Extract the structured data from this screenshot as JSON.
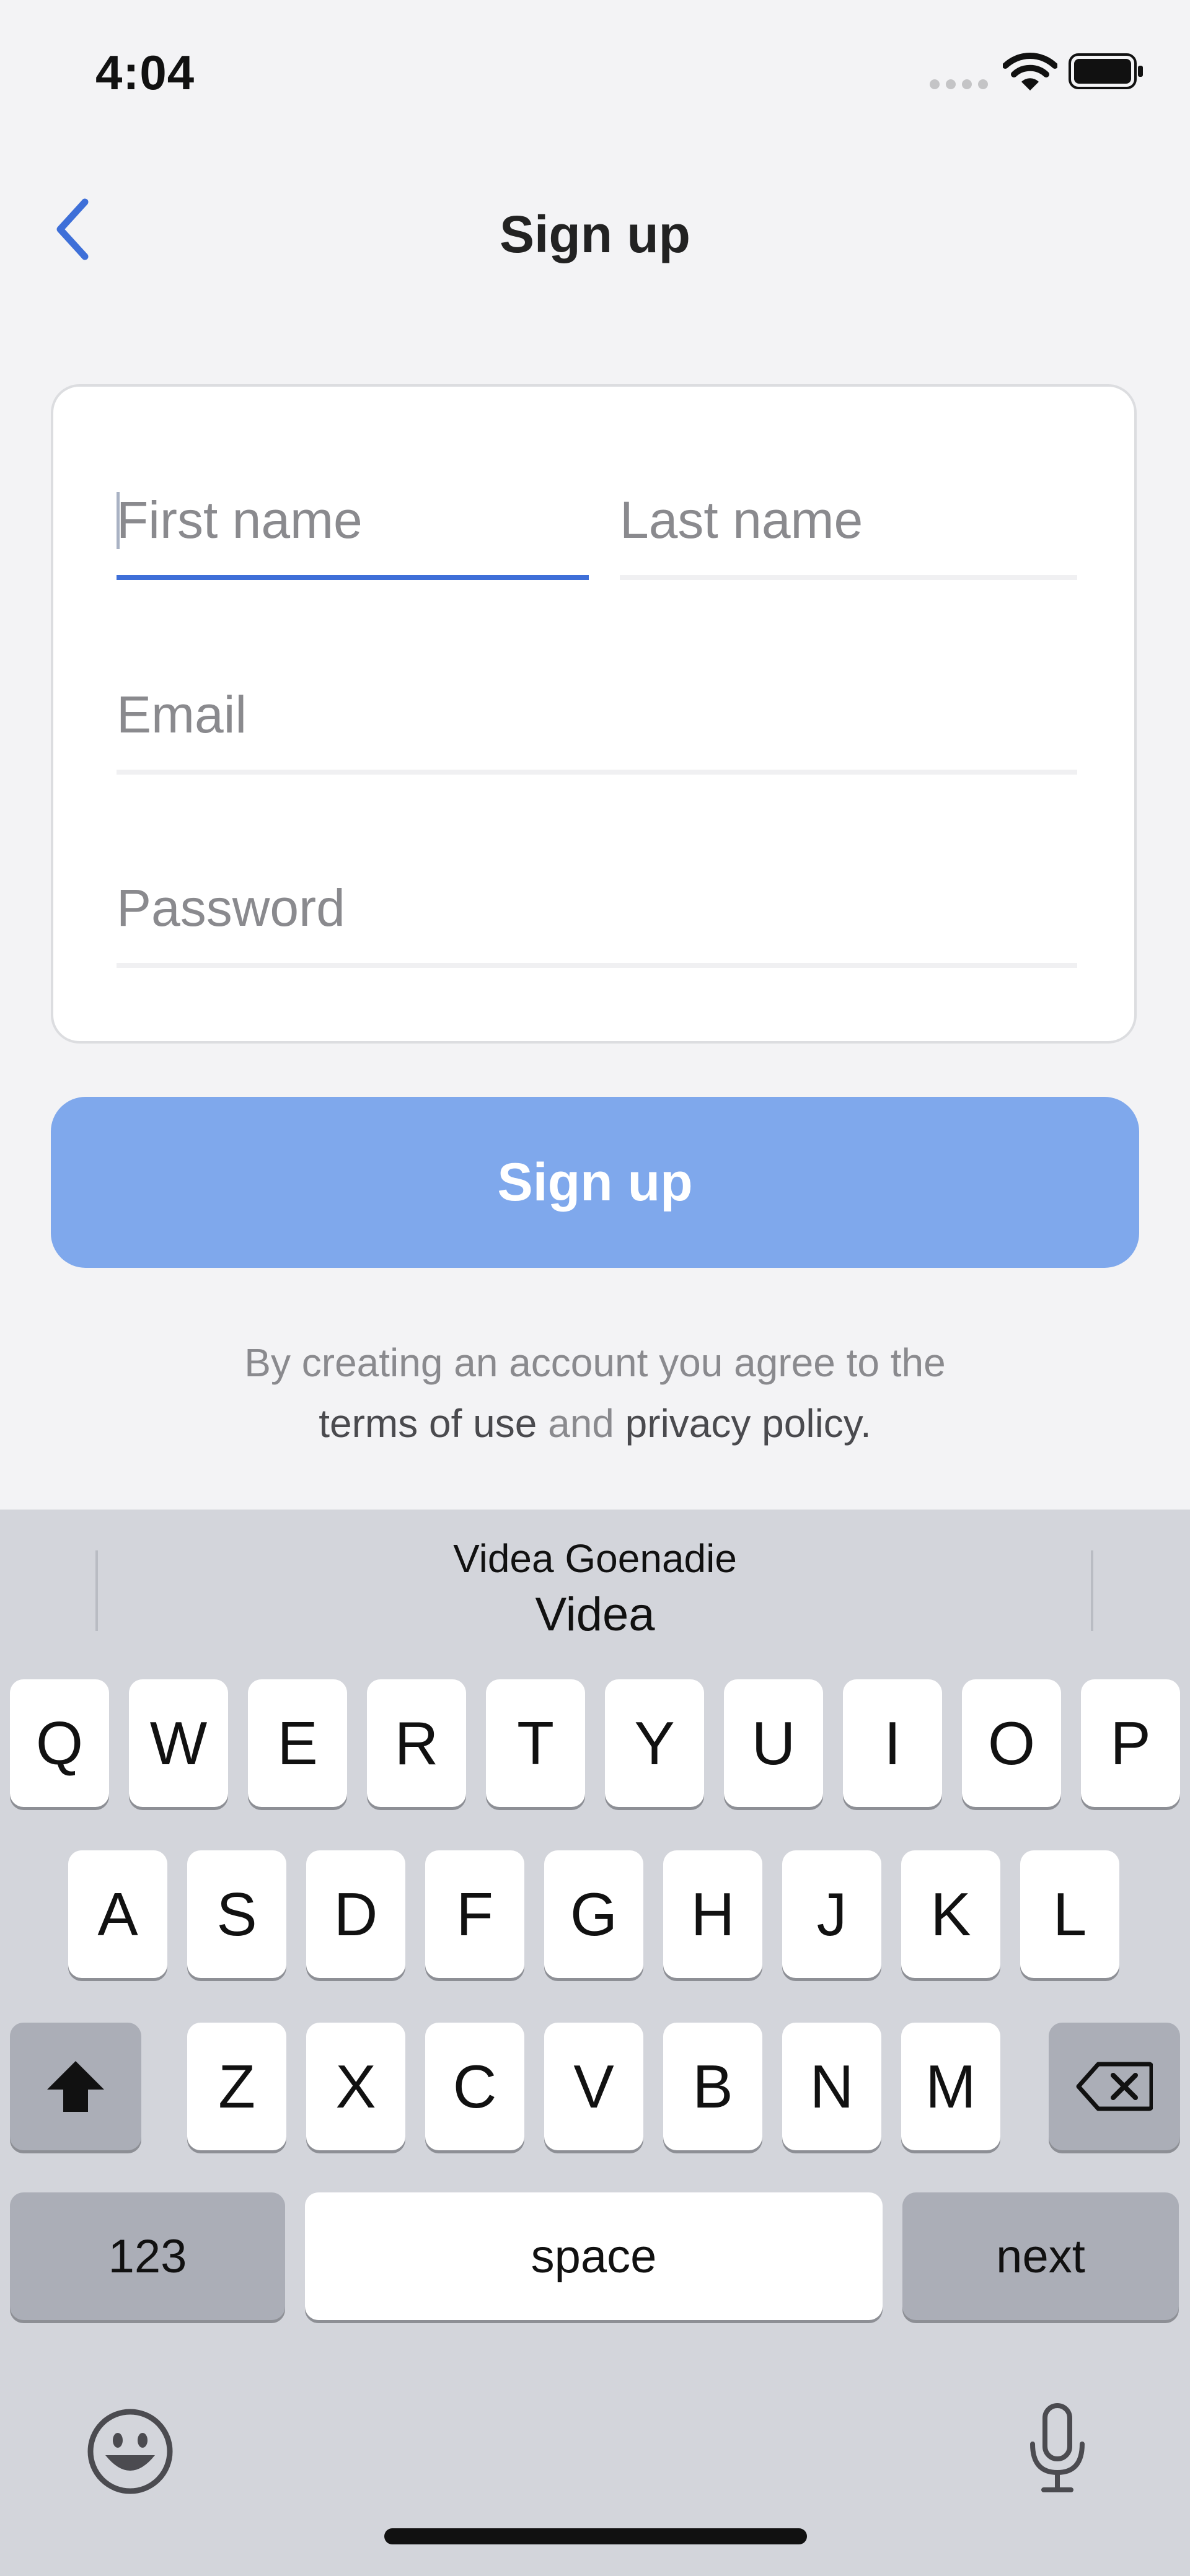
{
  "status_bar": {
    "time": "4:04"
  },
  "header": {
    "title": "Sign up"
  },
  "form": {
    "first_name": {
      "placeholder": "First name",
      "value": ""
    },
    "last_name": {
      "placeholder": "Last name",
      "value": ""
    },
    "email": {
      "placeholder": "Email",
      "value": ""
    },
    "password": {
      "placeholder": "Password",
      "value": ""
    }
  },
  "signup_button": {
    "label": "Sign up"
  },
  "terms": {
    "line1": "By creating an account you agree to the",
    "terms_link": "terms of use",
    "and": " and ",
    "privacy_link": "privacy policy",
    "period": "."
  },
  "keyboard": {
    "suggestion_top": "Videa Goenadie",
    "suggestion_main": "Videa",
    "row1": [
      "Q",
      "W",
      "E",
      "R",
      "T",
      "Y",
      "U",
      "I",
      "O",
      "P"
    ],
    "row2": [
      "A",
      "S",
      "D",
      "F",
      "G",
      "H",
      "J",
      "K",
      "L"
    ],
    "row3": [
      "Z",
      "X",
      "C",
      "V",
      "B",
      "N",
      "M"
    ],
    "numbers_label": "123",
    "space_label": "space",
    "return_label": "next"
  },
  "colors": {
    "accent": "#3e6fd8",
    "button_disabled": "#7fa8ec",
    "keyboard_bg": "#d3d5db"
  }
}
